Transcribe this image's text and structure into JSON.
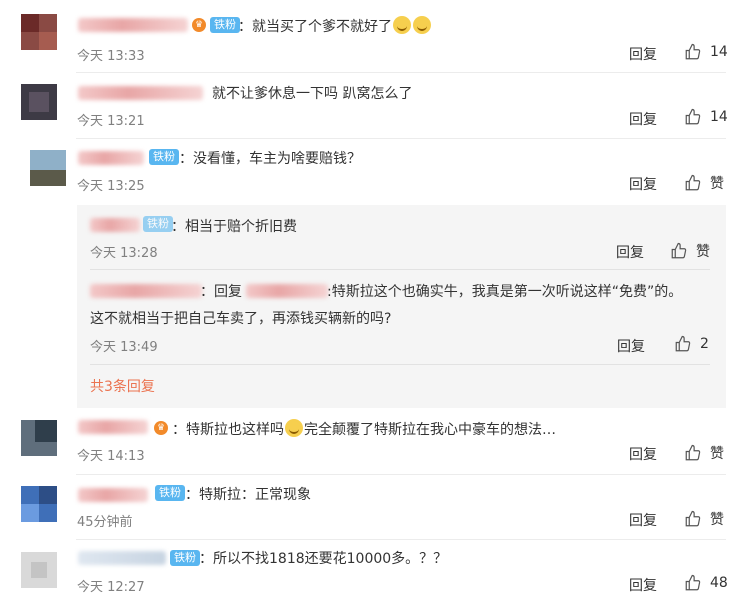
{
  "comments": [
    {
      "text": "：就当买了个爹不就好了",
      "badge": "铁粉",
      "time": "今天 13:33",
      "reply": "回复",
      "likes": "14"
    },
    {
      "text": "就不让爹休息一下吗 趴窝怎么了",
      "time": "今天 13:21",
      "reply": "回复",
      "likes": "14"
    },
    {
      "text": "：没看懂，车主为啥要赔钱？",
      "badge": "铁粉",
      "time": "今天 13:25",
      "reply": "回复",
      "likes": "赞"
    },
    {
      "text": "：特斯拉也这样吗",
      "text2": "完全颠覆了特斯拉在我心中豪车的想法…",
      "time": "今天 14:13",
      "reply": "回复",
      "likes": "赞"
    },
    {
      "text": "：特斯拉：正常现象",
      "badge": "铁粉",
      "time": "45分钟前",
      "reply": "回复",
      "likes": "赞"
    },
    {
      "text": "：所以不找1818还要花10000多。？？",
      "badge": "铁粉",
      "time": "今天 12:27",
      "reply": "回复",
      "likes": "48"
    }
  ],
  "replies": [
    {
      "text": "：相当于赔个折旧费",
      "badge": "铁粉",
      "time": "今天 13:28",
      "reply": "回复",
      "likes": "赞"
    },
    {
      "prefix": "：回复",
      "line1": ":特斯拉这个也确实牛，我真是第一次听说这样“免费”的。",
      "line2": "这不就相当于把自己车卖了，再添钱买辆新的吗?",
      "time": "今天 13:49",
      "reply": "回复",
      "likes": "2"
    }
  ],
  "more_replies": "共3条回复",
  "icons": {
    "like": "thumbs-up-icon",
    "vip": "vip-crown-icon",
    "emoji": "emoji-icon"
  },
  "colors": {
    "badge": "#59b6f0",
    "more": "#eb7350",
    "time": "#808080"
  }
}
